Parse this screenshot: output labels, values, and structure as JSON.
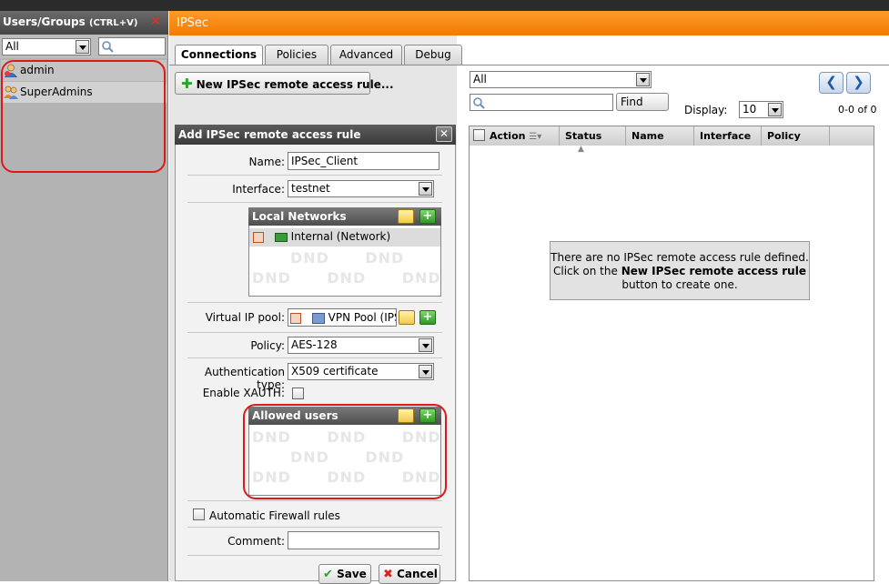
{
  "left_panel": {
    "title": "Users/Groups",
    "shortcut": "(CTRL+V)",
    "filter_value": "All",
    "search_placeholder": "",
    "items": [
      {
        "label": "admin",
        "icon": "user-icon"
      },
      {
        "label": "SuperAdmins",
        "icon": "group-icon"
      }
    ]
  },
  "header": {
    "title": "IPSec"
  },
  "tabs": [
    "Connections",
    "Policies",
    "Advanced",
    "Debug"
  ],
  "new_rule_button": "New IPSec remote access rule...",
  "form": {
    "title": "Add IPSec remote access rule",
    "name_label": "Name:",
    "name_value": "IPSec_Client",
    "interface_label": "Interface:",
    "interface_value": "testnet",
    "local_networks": {
      "title": "Local Networks",
      "items": [
        "Internal (Network)"
      ],
      "dnd_text": "DND"
    },
    "virtual_ip_pool_label": "Virtual IP pool:",
    "virtual_ip_pool_value": "VPN Pool (IPS",
    "policy_label": "Policy:",
    "policy_value": "AES-128",
    "auth_type_label": "Authentication type:",
    "auth_type_value": "X509 certificate",
    "enable_xauth_label": "Enable XAUTH:",
    "enable_xauth_checked": false,
    "allowed_users": {
      "title": "Allowed users",
      "dnd_text": "DND"
    },
    "auto_firewall_label": "Automatic Firewall rules",
    "auto_firewall_checked": false,
    "comment_label": "Comment:",
    "comment_value": "",
    "save_label": "Save",
    "cancel_label": "Cancel"
  },
  "list": {
    "filter_value": "All",
    "search_value": "",
    "find_label": "Find",
    "display_label": "Display:",
    "display_value": "10",
    "count_text": "0-0 of 0",
    "columns": [
      "Action",
      "Status",
      "Name",
      "Interface",
      "Policy"
    ],
    "empty_line1": "There are no IPSec remote access rule defined.",
    "empty_line2_prefix": "Click on the",
    "empty_line2_bold": "New IPSec remote access rule",
    "empty_line3": "button to create one."
  },
  "colors": {
    "accent": "#f07c00",
    "highlight_ring": "#e01818",
    "add_green": "#2aa52a"
  }
}
